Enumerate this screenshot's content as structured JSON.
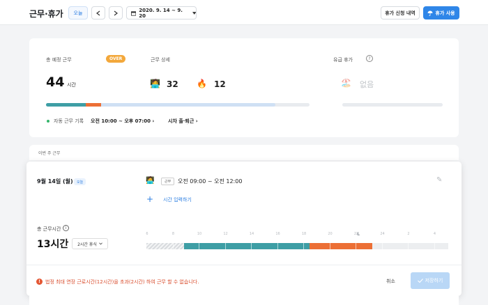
{
  "header": {
    "title": "근무·휴가",
    "today_label": "오늘",
    "date_range": "2020. 9. 14 ~ 9. 20",
    "history_label": "휴가 신청 내역",
    "vacation_label": "휴가 사용"
  },
  "summary": {
    "scheduled_label": "총 예정 근무",
    "over_badge": "OVER",
    "hours_value": "44",
    "hours_unit": "시간",
    "detail_label": "근무 상세",
    "stat_a_value": "32",
    "stat_b_value": "12",
    "paid_leave_label": "유급 휴가",
    "paid_leave_value": "없음",
    "auto_record_label": "자동 근무 기록",
    "auto_record_time": "오전 10:00 ~ 오후 07:00",
    "commute_label": "시차 출·퇴근",
    "progress": {
      "teal": 0.15,
      "orange": 0.06,
      "light": 0.66
    }
  },
  "week": {
    "label": "이번 주 근무"
  },
  "day": {
    "title": "9월 14일 (월)",
    "today_badge": "오늘",
    "work_tag": "근무",
    "work_time": "오전 09:00 ~ 오전 12:00",
    "add_time_label": "시간 입력하기",
    "total_label": "총 근무시간",
    "total_hours": "13시간",
    "break_label": "2시간 휴식",
    "ticks": [
      "6",
      "8",
      "10",
      "12",
      "14",
      "16",
      "18",
      "20",
      "22",
      "24",
      "2",
      "4"
    ],
    "moon_icon": "moon-icon",
    "warning": "법정 최대 연장 근로시간(12시간)을 초과(2시간) 하여 근무 할 수 없습니다.",
    "cancel_label": "취소",
    "save_label": "저장하기"
  },
  "colors": {
    "teal": "#3e9ea5",
    "orange": "#ec6f35",
    "light_blue": "#cfe0f4",
    "accent": "#2f86e8",
    "warning": "#e45734"
  }
}
